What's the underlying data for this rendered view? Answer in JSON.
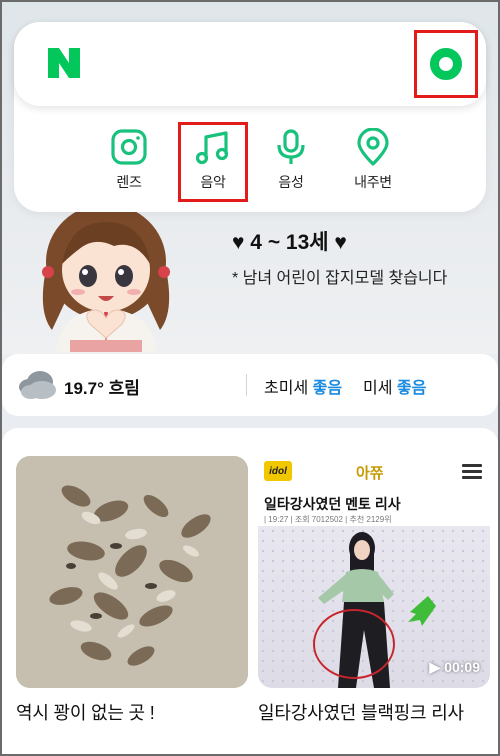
{
  "header": {
    "logo_letter": "N",
    "logo_color": "#03c75a"
  },
  "search_tools": [
    {
      "label": "렌즈",
      "icon": "lens-icon"
    },
    {
      "label": "음악",
      "icon": "music-note-icon"
    },
    {
      "label": "음성",
      "icon": "microphone-icon"
    },
    {
      "label": "내주변",
      "icon": "location-pin-icon"
    }
  ],
  "ad_banner": {
    "title": "♥ 4 ~ 13세 ♥",
    "subtitle": "* 남녀 어린이 잡지모델 찾습니다"
  },
  "weather": {
    "icon": "cloud-icon",
    "temp_text": "19.7° 흐림",
    "fine_dust_label": "초미세",
    "fine_dust_value": "좋음",
    "dust_label": "미세",
    "dust_value": "좋음"
  },
  "feed": [
    {
      "caption": "역시 꽝이 없는 곳 !"
    },
    {
      "caption": "일타강사였던 블랙핑크 리사",
      "brand": "아쮸",
      "logo": "idol",
      "article_title": "일타강사였던 멘토 리사",
      "meta": "| 19:27 | 조회 7012502 | 추천 2129위",
      "duration": "▶ 00:09"
    }
  ],
  "colors": {
    "accent_green": "#03c75a",
    "highlight_red": "#e21b1b",
    "good_blue": "#1a8be0"
  }
}
